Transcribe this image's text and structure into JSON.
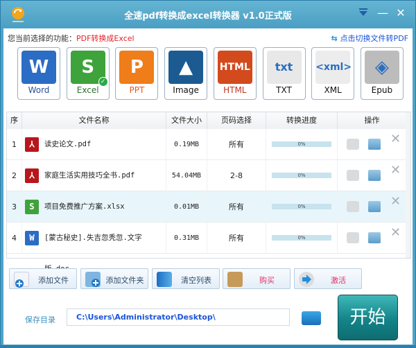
{
  "window": {
    "title": "全速pdf转换成excel转换器 v1.0正式版"
  },
  "function_bar": {
    "label": "您当前选择的功能：",
    "value": "PDF转换成Excel",
    "switch_link": "点击切换文件转PDF"
  },
  "formats": [
    {
      "label": "Word",
      "glyph": "W",
      "color": "#2b6cc4",
      "text_color": "#2a4f9a"
    },
    {
      "label": "Excel",
      "glyph": "S",
      "color": "#3ea33a",
      "text_color": "#2d6e2d",
      "selected": true
    },
    {
      "label": "PPT",
      "glyph": "P",
      "color": "#ef7d1a",
      "text_color": "#e8561a"
    },
    {
      "label": "Image",
      "glyph": "▲",
      "color": "#1c5b92",
      "text_color": "#111"
    },
    {
      "label": "HTML",
      "glyph": "HTML",
      "color": "#d34a1c",
      "text_color": "#c0321c"
    },
    {
      "label": "TXT",
      "glyph": "txt",
      "color": "#e8e8e8",
      "text_color": "#111"
    },
    {
      "label": "XML",
      "glyph": "<xml>",
      "color": "#ececec",
      "text_color": "#111"
    },
    {
      "label": "Epub",
      "glyph": "◈",
      "color": "#bcbcbc",
      "text_color": "#111"
    }
  ],
  "table": {
    "headers": [
      "序",
      "文件名称",
      "文件大小",
      "页码选择",
      "转换进度",
      "操作"
    ],
    "rows": [
      {
        "index": "1",
        "name": "读史论文.pdf",
        "size": "0.19MB",
        "pages": "所有",
        "progress": "0%",
        "type": "pdf"
      },
      {
        "index": "2",
        "name": "家庭生活实用技巧全书.pdf",
        "size": "54.04MB",
        "pages": "2-8",
        "progress": "0%",
        "type": "pdf"
      },
      {
        "index": "3",
        "name": "项目免费推广方案.xlsx",
        "size": "0.01MB",
        "pages": "所有",
        "progress": "0%",
        "type": "xlsx",
        "selected": true
      },
      {
        "index": "4",
        "name": "[蒙古秘史].失吉忽秃忽.文字版.doc",
        "size": "0.31MB",
        "pages": "所有",
        "progress": "0%",
        "type": "doc"
      }
    ]
  },
  "buttons": {
    "add_file": "添加文件",
    "add_folder": "添加文件夹",
    "clear_list": "清空列表",
    "buy": "购买",
    "activate": "激活"
  },
  "save": {
    "label": "保存目录",
    "path": "C:\\Users\\Administrator\\Desktop\\"
  },
  "start_label": "开始"
}
